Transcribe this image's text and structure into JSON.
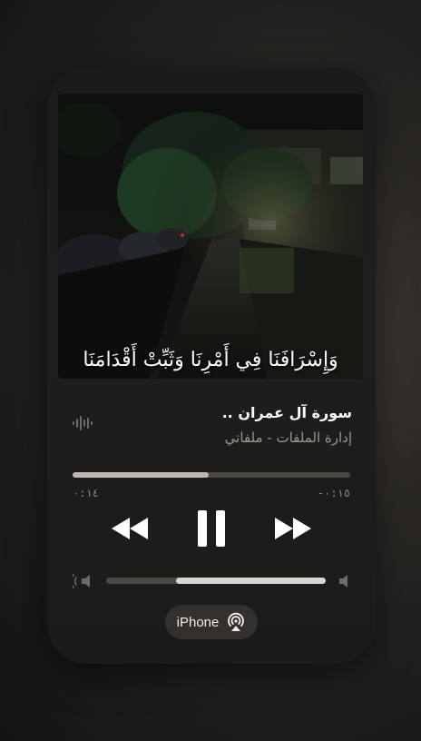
{
  "player": {
    "artwork_caption": "وَإِسْرَافَنَا فِي أَمْرِنَا وَثَبِّتْ أَقْدَامَنَا",
    "track_title": "سورة آل عمران ..",
    "track_subtitle": "إدارة الملفات - ملفاتي",
    "elapsed": "٠:١٤",
    "remaining": "-٠:١٥",
    "progress_fraction": 0.49,
    "volume_fraction": 0.68,
    "airplay_label": "iPhone",
    "icons": {
      "waveform": "waveform-icon",
      "rewind": "backward-icon",
      "pause": "pause-icon",
      "forward": "forward-icon",
      "volume_low": "speaker-low-icon",
      "volume_high": "speaker-high-icon",
      "airplay": "airplay-icon"
    },
    "colors": {
      "accent": "#ffffff",
      "secondary_text": "#9a958f",
      "track": "#4b4743",
      "fill": "#bdb8b2"
    }
  }
}
